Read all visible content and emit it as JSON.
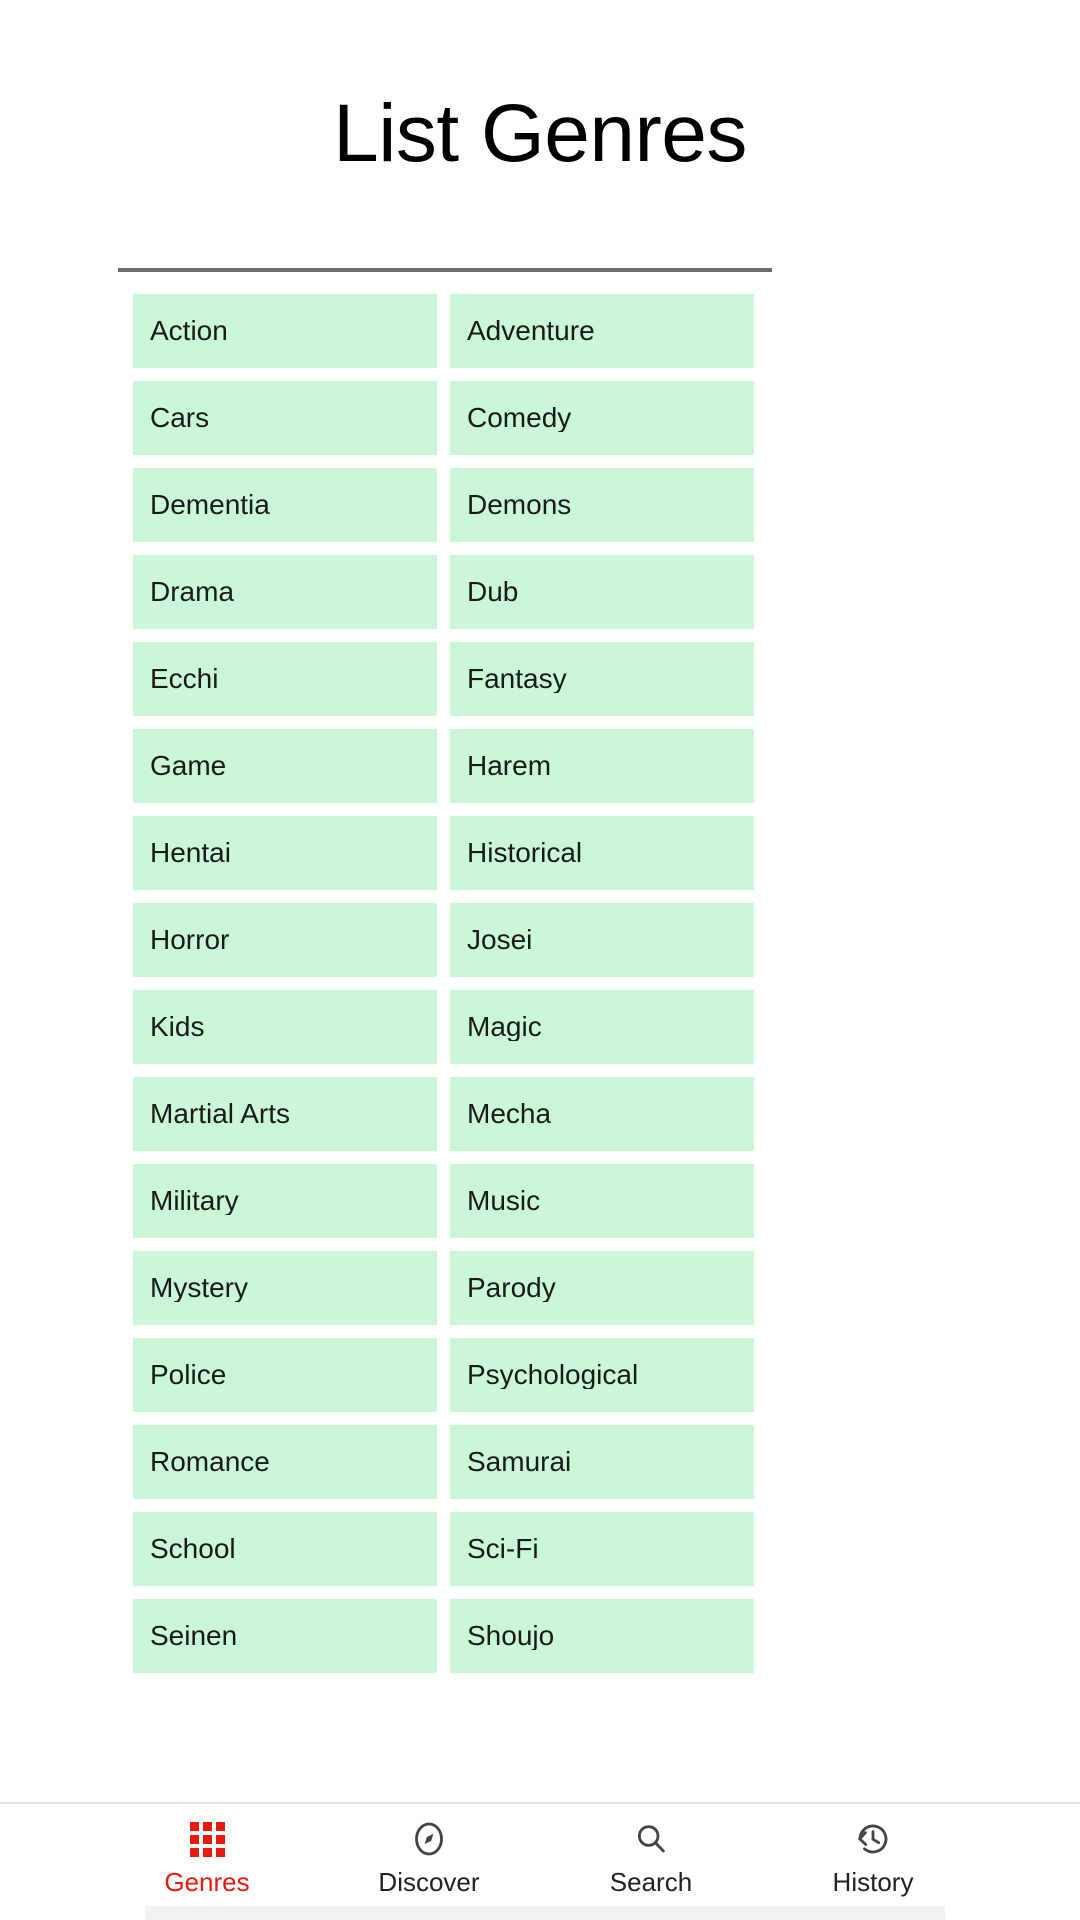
{
  "header": {
    "title": "List Genres"
  },
  "colors": {
    "chip_background": "#C9F7D7",
    "chip_text": "#1A1A1A",
    "divider": "#6B6B6B",
    "nav_active": "#E8190F",
    "nav_inactive": "#222222",
    "page_background": "#FFFFFF"
  },
  "genres": [
    {
      "label": "Action"
    },
    {
      "label": "Adventure"
    },
    {
      "label": "Cars"
    },
    {
      "label": "Comedy"
    },
    {
      "label": "Dementia"
    },
    {
      "label": "Demons"
    },
    {
      "label": "Drama"
    },
    {
      "label": "Dub"
    },
    {
      "label": "Ecchi"
    },
    {
      "label": "Fantasy"
    },
    {
      "label": "Game"
    },
    {
      "label": "Harem"
    },
    {
      "label": "Hentai"
    },
    {
      "label": "Historical"
    },
    {
      "label": "Horror"
    },
    {
      "label": "Josei"
    },
    {
      "label": "Kids"
    },
    {
      "label": "Magic"
    },
    {
      "label": "Martial Arts"
    },
    {
      "label": "Mecha"
    },
    {
      "label": "Military"
    },
    {
      "label": "Music"
    },
    {
      "label": "Mystery"
    },
    {
      "label": "Parody"
    },
    {
      "label": "Police"
    },
    {
      "label": "Psychological"
    },
    {
      "label": "Romance"
    },
    {
      "label": "Samurai"
    },
    {
      "label": "School"
    },
    {
      "label": "Sci-Fi"
    },
    {
      "label": "Seinen"
    },
    {
      "label": "Shoujo"
    }
  ],
  "bottom_nav": {
    "active_index": 0,
    "items": [
      {
        "label": "Genres",
        "icon": "grid-icon",
        "active": true
      },
      {
        "label": "Discover",
        "icon": "compass-icon",
        "active": false
      },
      {
        "label": "Search",
        "icon": "search-icon",
        "active": false
      },
      {
        "label": "History",
        "icon": "history-icon",
        "active": false
      }
    ]
  }
}
